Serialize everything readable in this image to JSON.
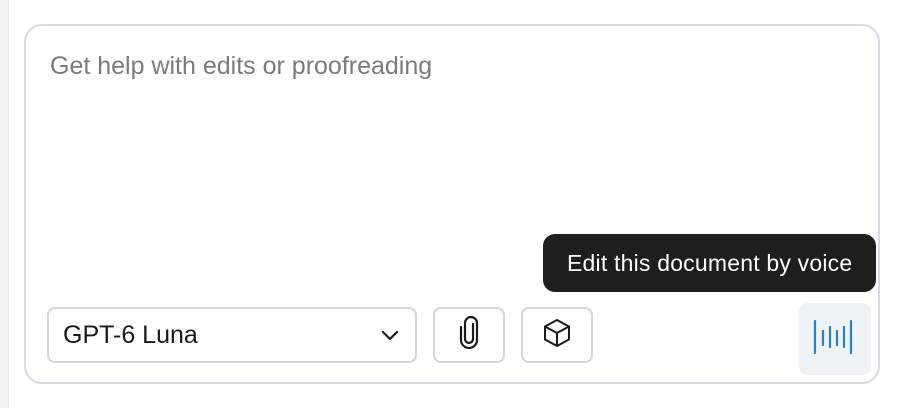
{
  "composer": {
    "placeholder": "Get help with edits or proofreading",
    "value": ""
  },
  "toolbar": {
    "model_selected": "GPT-6 Luna",
    "attach_icon": "paperclip-icon",
    "package_icon": "cube-icon",
    "voice_icon": "voice-waveform-icon"
  },
  "tooltip": {
    "text": "Edit this document by voice"
  },
  "colors": {
    "border": "#d4dbe2",
    "placeholder": "#7b7b7e",
    "tooltip_bg": "#1e1e1e",
    "voice_accent": "#2f80c2",
    "voice_bg": "#eef3f8"
  }
}
